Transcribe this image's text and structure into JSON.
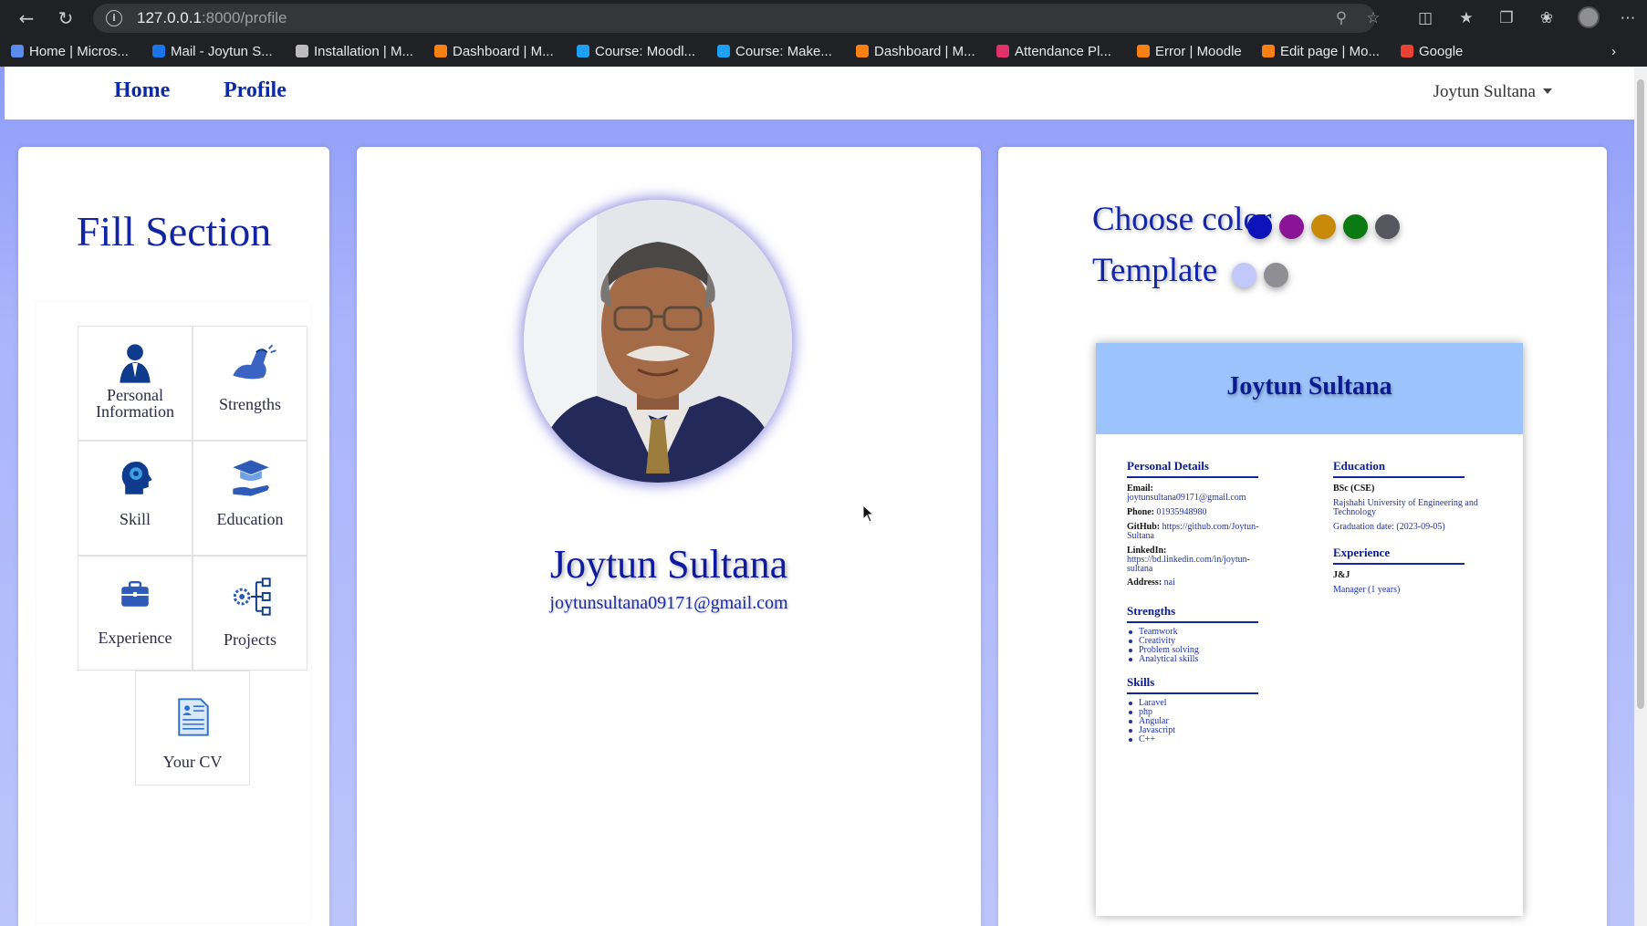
{
  "browser": {
    "url_host": "127.0.0.1",
    "url_path": ":8000/profile",
    "bookmarks": [
      {
        "label": "Home | Micros...",
        "color": "#5b8def"
      },
      {
        "label": "Mail - Joytun S...",
        "color": "#1a73e8"
      },
      {
        "label": "Installation | M...",
        "color": "#bdbdbd"
      },
      {
        "label": "Dashboard | M...",
        "color": "#f98012"
      },
      {
        "label": "Course: Moodl...",
        "color": "#1ea1f2"
      },
      {
        "label": "Course: Make...",
        "color": "#1ea1f2"
      },
      {
        "label": "Dashboard | M...",
        "color": "#f98012"
      },
      {
        "label": "Attendance Pl...",
        "color": "#e0316a"
      },
      {
        "label": "Error | Moodle",
        "color": "#f98012"
      },
      {
        "label": "Edit page | Mo...",
        "color": "#f98012"
      },
      {
        "label": "Google",
        "color": "#ea4335"
      }
    ]
  },
  "navbar": {
    "home": "Home",
    "profile": "Profile",
    "user": "Joytun Sultana"
  },
  "fill_section": {
    "title": "Fill Section",
    "tiles": [
      {
        "label_line1": "Personal",
        "label_line2": "Information",
        "icon": "person-icon"
      },
      {
        "label_line1": "Strengths",
        "label_line2": "",
        "icon": "flexed-arm-icon"
      },
      {
        "label_line1": "Skill",
        "label_line2": "",
        "icon": "head-brain-icon"
      },
      {
        "label_line1": "Education",
        "label_line2": "",
        "icon": "graduation-cap-icon"
      },
      {
        "label_line1": "Experience",
        "label_line2": "",
        "icon": "briefcase-icon"
      },
      {
        "label_line1": "Projects",
        "label_line2": "",
        "icon": "gear-network-icon"
      },
      {
        "label_line1": "Your CV",
        "label_line2": "",
        "icon": "document-icon"
      }
    ]
  },
  "profile": {
    "name": "Joytun Sultana",
    "email": "joytunsultana09171@gmail.com"
  },
  "options": {
    "choose_color_label": "Choose color",
    "colors": [
      "#0d13b8",
      "#8b1496",
      "#c88a08",
      "#0c7a12",
      "#55565e"
    ],
    "template_label": "Template",
    "templates": [
      "#c3c8fb",
      "#8f8f93"
    ]
  },
  "cv": {
    "name": "Joytun Sultana",
    "personal_details": {
      "heading": "Personal Details",
      "email_label": "Email:",
      "email": "joytunsultana09171@gmail.com",
      "phone_label": "Phone:",
      "phone": "01935948980",
      "github_label": "GitHub:",
      "github_1": "https://github.com/Joytun-",
      "github_2": "Sultana",
      "linkedin_label": "LinkedIn:",
      "linkedin_1": "https://bd.linkedin.com/in/joytun-",
      "linkedin_2": "sultana",
      "address_label": "Address:",
      "address": "nai"
    },
    "strengths": {
      "heading": "Strengths",
      "items": [
        "Teamwork",
        "Creativity",
        "Problem solving",
        "Analytical skills"
      ]
    },
    "skills": {
      "heading": "Skills",
      "items": [
        "Laravel",
        "php",
        "Angular",
        "Javascript",
        "C++"
      ]
    },
    "education": {
      "heading": "Education",
      "degree": "BSc (CSE)",
      "institution_1": "Rajshahi University of Engineering and",
      "institution_2": "Technology",
      "graduation": "Graduation date: (2023-09-05)"
    },
    "experience": {
      "heading": "Experience",
      "company": "J&J",
      "role": "Manager (1 years)"
    }
  }
}
